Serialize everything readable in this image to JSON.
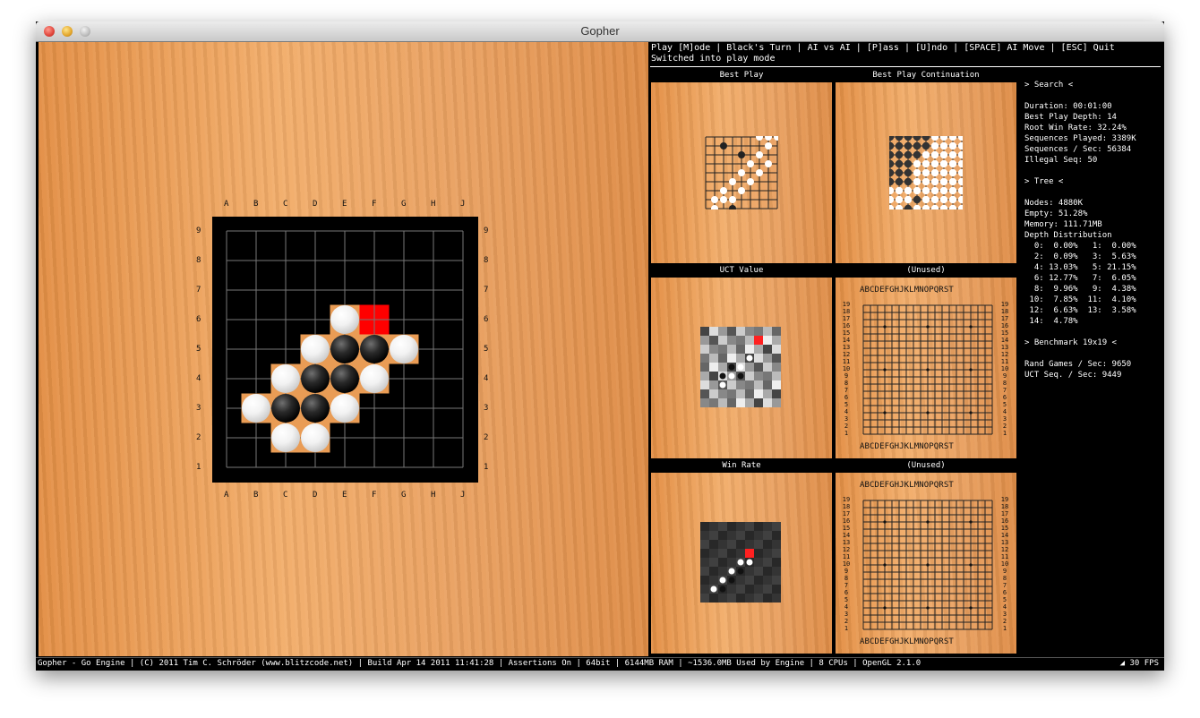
{
  "window": {
    "title": "Gopher"
  },
  "board": {
    "columns": [
      "A",
      "B",
      "C",
      "D",
      "E",
      "F",
      "G",
      "H",
      "J"
    ],
    "rows": [
      "9",
      "8",
      "7",
      "6",
      "5",
      "4",
      "3",
      "2",
      "1"
    ],
    "stones": [
      {
        "col": 4,
        "row": 6,
        "color": "white"
      },
      {
        "col": 3,
        "row": 5,
        "color": "white"
      },
      {
        "col": 4,
        "row": 5,
        "color": "black"
      },
      {
        "col": 5,
        "row": 5,
        "color": "black"
      },
      {
        "col": 6,
        "row": 5,
        "color": "white"
      },
      {
        "col": 2,
        "row": 4,
        "color": "white"
      },
      {
        "col": 3,
        "row": 4,
        "color": "black"
      },
      {
        "col": 4,
        "row": 4,
        "color": "black"
      },
      {
        "col": 5,
        "row": 4,
        "color": "white"
      },
      {
        "col": 1,
        "row": 3,
        "color": "white"
      },
      {
        "col": 2,
        "row": 3,
        "color": "black"
      },
      {
        "col": 3,
        "row": 3,
        "color": "black"
      },
      {
        "col": 4,
        "row": 3,
        "color": "white"
      },
      {
        "col": 2,
        "row": 2,
        "color": "white"
      },
      {
        "col": 3,
        "row": 2,
        "color": "white"
      }
    ],
    "marked_cell": {
      "col": 5,
      "row": 6
    },
    "colors": {
      "wood": "#e99c55",
      "frame": "#000000",
      "marker": "#ff0000"
    }
  },
  "status": {
    "menu": "Play [M]ode | Black's Turn | AI vs AI | [P]ass | [U]ndo | [SPACE] AI Move | [ESC] Quit",
    "message": "Switched into play mode"
  },
  "panels": {
    "best_play": "Best Play",
    "best_continuation": "Best Play Continuation",
    "uct_value": "UCT Value",
    "unused_1": "(Unused)",
    "win_rate": "Win Rate",
    "unused_2": "(Unused)",
    "big_columns": "ABCDEFGHJKLMNOPQRST",
    "big_rows": [
      "19",
      "18",
      "17",
      "16",
      "15",
      "14",
      "13",
      "12",
      "11",
      "10",
      "9",
      "8",
      "7",
      "6",
      "5",
      "4",
      "3",
      "2",
      "1"
    ]
  },
  "search": {
    "header": "> Search <",
    "duration": "Duration: 00:01:00",
    "depth": "Best Play Depth: 14",
    "win_rate": "Root Win Rate: 32.24%",
    "sequences": "Sequences Played: 3389K",
    "seq_per_sec": "Sequences / Sec: 56384",
    "illegal": "Illegal Seq: 50"
  },
  "tree": {
    "header": "> Tree <",
    "nodes": "Nodes: 4880K",
    "empty": "Empty: 51.28%",
    "memory": "Memory: 111.71MB",
    "depth_title": "Depth Distribution",
    "depth_rows": [
      "  0:  0.00%   1:  0.00%",
      "  2:  0.09%   3:  5.63%",
      "  4: 13.03%   5: 21.15%",
      "  6: 12.77%   7:  6.05%",
      "  8:  9.96%   9:  4.38%",
      " 10:  7.85%  11:  4.10%",
      " 12:  6.63%  13:  3.58%",
      " 14:  4.78%"
    ]
  },
  "benchmark": {
    "header": "> Benchmark 19x19 <",
    "rand": "Rand Games / Sec: 9650",
    "uct": "UCT Seq. / Sec: 9449"
  },
  "footer": {
    "text": "Gopher - Go Engine | (C) 2011 Tim C. Schröder (www.blitzcode.net) | Build Apr 14 2011 11:41:28 | Assertions On | 64bit | 6144MB RAM | ~1536.0MB Used by Engine | 8 CPUs | OpenGL 2.1.0",
    "fps": "30 FPS"
  }
}
